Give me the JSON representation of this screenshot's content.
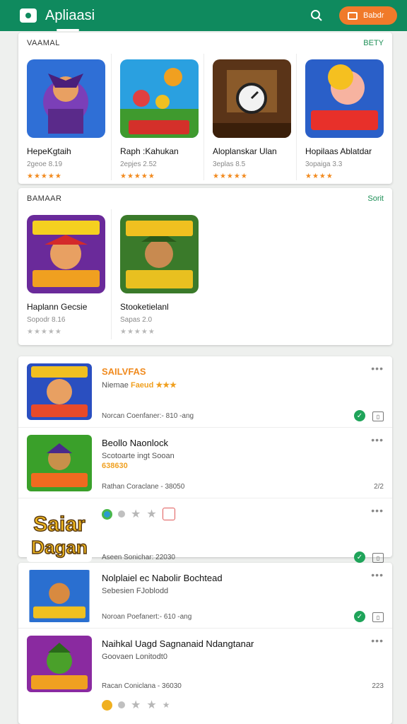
{
  "appbar": {
    "title": "Apliaasi",
    "action_label": "Babdr",
    "icons": [
      "app-logo-icon",
      "search-icon",
      "store-icon"
    ],
    "colors": {
      "primary": "#0f8a5e",
      "accent": "#f07a2a"
    }
  },
  "sections": [
    {
      "title": "VAAMAL",
      "more": "BETY",
      "tiles": [
        {
          "name": "HepeKgtaih",
          "sub": "2geoe 8.19",
          "stars": "★★★★★"
        },
        {
          "name": "Raph :Kahukan",
          "sub": "2epjes 2.52",
          "stars": "★★★★★"
        },
        {
          "name": "Aloplanskar Ulan",
          "sub": "3eplas 8.5",
          "stars": "★★★★★"
        },
        {
          "name": "Hopilaas Ablatdar",
          "sub": "3opaiga 3.3",
          "stars": "★★★★"
        }
      ]
    },
    {
      "title": "BAMAAR",
      "more": "Sorit",
      "tiles": [
        {
          "name": "Haplann Gecsie",
          "sub": "Sopodr 8.16",
          "stars": "★★★★★"
        },
        {
          "name": "Stooketielanl",
          "sub": "Sapas 2.0",
          "stars": "★★★★★"
        }
      ]
    }
  ],
  "list1": [
    {
      "title": "SAILVFAS",
      "sub": "Niemae",
      "sub_hl": "Faeud ★★★",
      "meta": "Norcan Coenfaner:- 810 -ang",
      "num": ""
    },
    {
      "title": "Beollo Naonlock",
      "sub": "Scotoarte ingt Sooan",
      "badge": "638630",
      "meta": "Rathan Coraclane - 38050",
      "num": "2/2"
    },
    {
      "title": "",
      "sub": "",
      "meta": "Aseen Sonichar: 22030",
      "num": ""
    }
  ],
  "list2": [
    {
      "title": "Nolplaiel ec Nabolir Bochtead",
      "sub": "Sebesien FJoblodd",
      "meta": "Noroan Poefanert:- 610 -ang",
      "num": ""
    },
    {
      "title": "Naihkal Uagd Sagnanaid Ndangtanar",
      "sub": "Goovaen Lonitodt0",
      "meta": "Racan Coniclana - 36030",
      "num": "223"
    }
  ],
  "row_thumb_label": "Saiar Dagan"
}
